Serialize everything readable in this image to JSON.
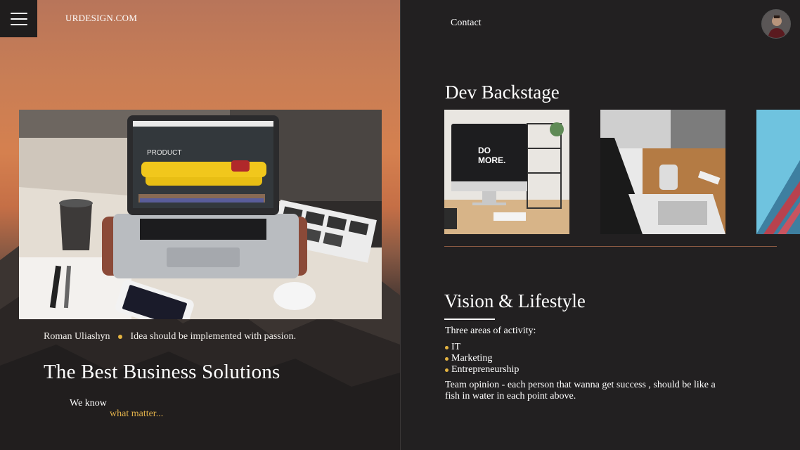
{
  "header": {
    "logo": "URDESIGN.COM",
    "contact_label": "Contact"
  },
  "hero": {
    "author": "Roman Uliashyn",
    "tagline": "Idea should be implemented with passion.",
    "title": "The Best Business Solutions",
    "we_know": "We know",
    "what_matter": "what matter...",
    "screen_heading": "PRODUCT"
  },
  "dev_backstage": {
    "title": "Dev Backstage",
    "thumbs": [
      {
        "icon": "imac-do-more-image",
        "screen_text_1": "DO",
        "screen_text_2": "MORE."
      },
      {
        "icon": "laptop-coffee-image"
      },
      {
        "icon": "building-facade-image"
      }
    ]
  },
  "vision": {
    "title": "Vision & Lifestyle",
    "areas_label": "Three areas of activity:",
    "areas": [
      "IT",
      "Marketing",
      "Entrepreneurship"
    ],
    "opinion": "Team opinion - each person that wanna get success , should be like a fish in water in each point above."
  },
  "colors": {
    "accent": "#e5b441",
    "background": "#222021",
    "divider": "#8a5a42"
  }
}
